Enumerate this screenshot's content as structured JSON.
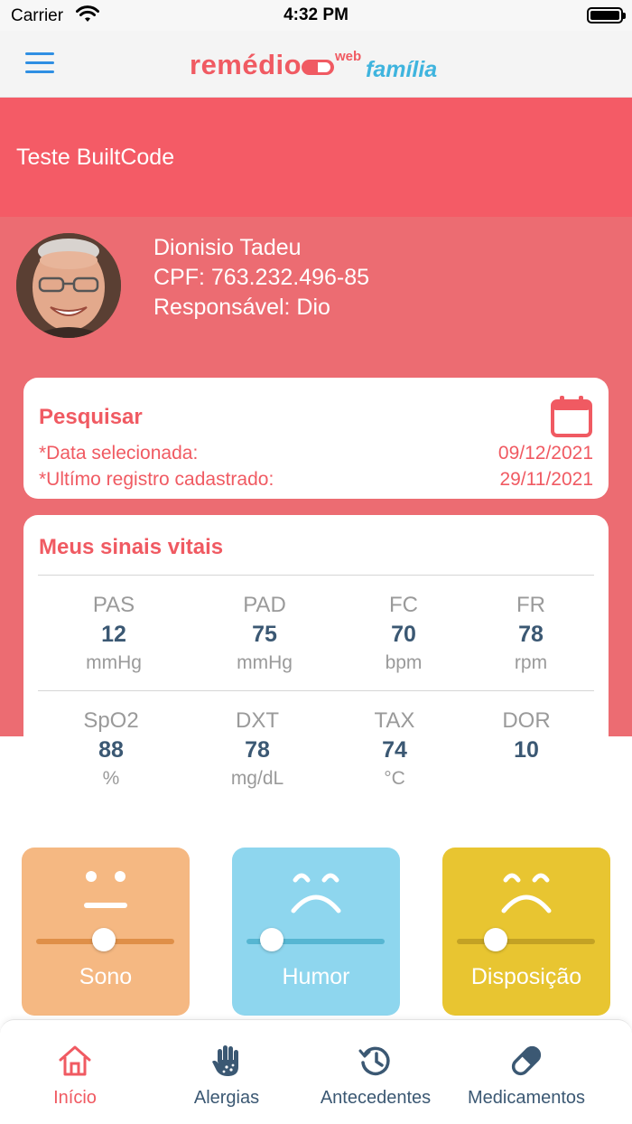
{
  "status_bar": {
    "carrier": "Carrier",
    "time": "4:32 PM"
  },
  "header": {
    "logo_main": "remédio",
    "logo_sup": "web",
    "logo_sub": "família"
  },
  "page": {
    "title": "Teste BuiltCode"
  },
  "profile": {
    "name": "Dionisio Tadeu",
    "cpf": "CPF: 763.232.496-85",
    "responsible": "Responsável: Dio"
  },
  "search": {
    "title": "Pesquisar",
    "selected_date_label": "*Data selecionada:",
    "selected_date": "09/12/2021",
    "last_record_label": "*Ultímo registro cadastrado:",
    "last_record": "29/11/2021"
  },
  "vitals": {
    "title": "Meus sinais vitais",
    "row1": [
      {
        "label": "PAS",
        "value": "12",
        "unit": "mmHg"
      },
      {
        "label": "PAD",
        "value": "75",
        "unit": "mmHg"
      },
      {
        "label": "FC",
        "value": "70",
        "unit": "bpm"
      },
      {
        "label": "FR",
        "value": "78",
        "unit": "rpm"
      }
    ],
    "row2": [
      {
        "label": "SpO2",
        "value": "88",
        "unit": "%"
      },
      {
        "label": "DXT",
        "value": "78",
        "unit": "mg/dL"
      },
      {
        "label": "TAX",
        "value": "74",
        "unit": "°C"
      },
      {
        "label": "DOR",
        "value": "10",
        "unit": ""
      }
    ]
  },
  "moods": [
    {
      "label": "Sono",
      "level": 0.49,
      "face": "neutral-face-icon",
      "color": "#f5b882"
    },
    {
      "label": "Humor",
      "level": 0.18,
      "face": "sad-face-icon",
      "color": "#8ed6ee"
    },
    {
      "label": "Disposição",
      "level": 0.28,
      "face": "sad-face-icon",
      "color": "#e8c531"
    }
  ],
  "tabs": [
    {
      "label": "Início",
      "icon": "home-icon",
      "active": true
    },
    {
      "label": "Alergias",
      "icon": "allergy-hand-icon",
      "active": false
    },
    {
      "label": "Antecedentes",
      "icon": "history-icon",
      "active": false
    },
    {
      "label": "Medicamentos",
      "icon": "pill-icon",
      "active": false
    }
  ],
  "colors": {
    "brand_red": "#f05a62",
    "header_red": "#f45b66",
    "profile_red": "#ec6c72",
    "accent_blue": "#2f8fe3",
    "value_navy": "#3b5873"
  }
}
